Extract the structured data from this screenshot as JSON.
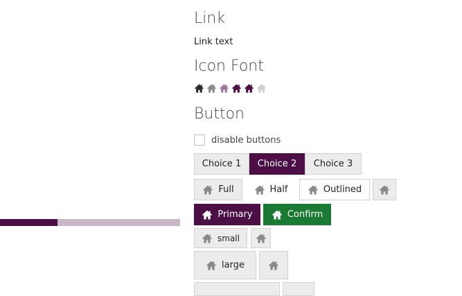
{
  "progress": {
    "fraction": 0.32,
    "fill_color": "#4b0f45",
    "track_color": "#c9b6c6"
  },
  "sections": {
    "link": {
      "title": "Link",
      "link_text": "Link text"
    },
    "icon_font": {
      "title": "Icon Font",
      "icons": [
        {
          "name": "home-icon",
          "color": "#2b2b2b"
        },
        {
          "name": "home-icon",
          "color": "#8a8a8a"
        },
        {
          "name": "home-icon",
          "color": "#9b7b97"
        },
        {
          "name": "home-icon",
          "color": "#4b0f45"
        },
        {
          "name": "home-icon",
          "color": "#4b0f45"
        },
        {
          "name": "home-icon",
          "color": "#d0d0d0"
        }
      ]
    },
    "button": {
      "title": "Button",
      "disable_label": "disable buttons",
      "choices": [
        "Choice 1",
        "Choice 2",
        "Choice 3"
      ],
      "selected_choice": "Choice 2",
      "variants": {
        "full": "Full",
        "half": "Half",
        "outlined": "Outlined"
      },
      "primary": "Primary",
      "confirm": "Confirm",
      "small": "small",
      "large": "large"
    }
  },
  "colors": {
    "accent": "#4b0f45",
    "confirm": "#1a7a33",
    "icon_grey": "#8a8a8a"
  }
}
